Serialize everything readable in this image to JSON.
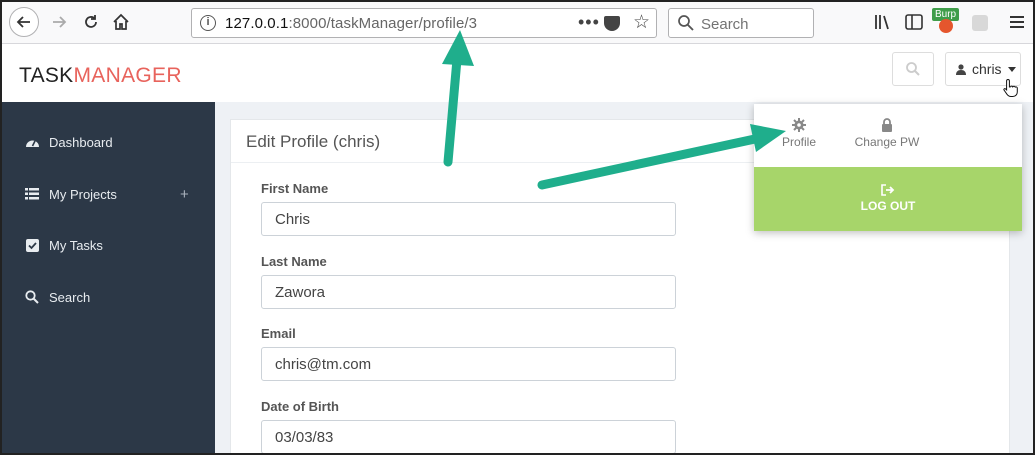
{
  "browser": {
    "url_host": "127.0.0.1",
    "url_path": ":8000/taskManager/profile/3",
    "url_dots": "•••",
    "search_placeholder": "Search",
    "burp_badge": "Burp"
  },
  "app": {
    "logo_part1": "TASK",
    "logo_part2": "MANAGER",
    "user_name": "chris",
    "brand_color": "#e8635c"
  },
  "sidebar": {
    "items": [
      {
        "label": "Dashboard",
        "icon": "dashboard-icon"
      },
      {
        "label": "My Projects",
        "icon": "list-icon",
        "extra": "+"
      },
      {
        "label": "My Tasks",
        "icon": "checkbox-icon"
      },
      {
        "label": "Search",
        "icon": "search-icon"
      }
    ]
  },
  "panel": {
    "title": "Edit Profile (chris)",
    "fields": [
      {
        "label": "First Name",
        "value": "Chris"
      },
      {
        "label": "Last Name",
        "value": "Zawora"
      },
      {
        "label": "Email",
        "value": "chris@tm.com"
      },
      {
        "label": "Date of Birth",
        "value": "03/03/83"
      }
    ]
  },
  "dropdown": {
    "profile_label": "Profile",
    "change_pw_label": "Change PW",
    "logout_label": "LOG OUT",
    "logout_color": "#a7d56a"
  },
  "annotations": {
    "arrow_color": "#1fae8c"
  }
}
